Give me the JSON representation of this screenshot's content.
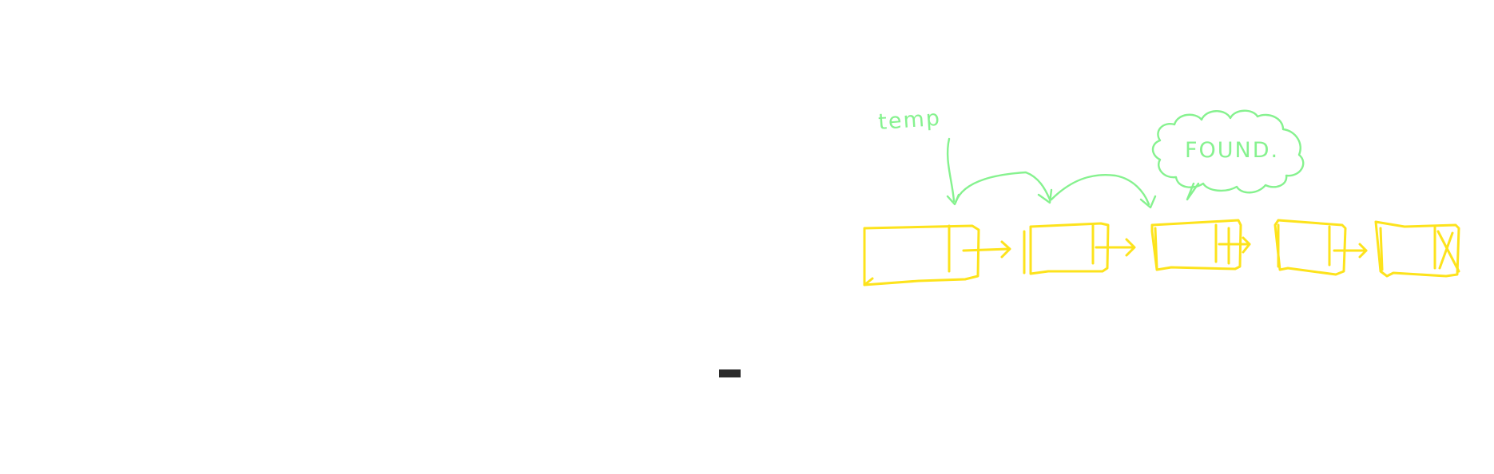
{
  "colors": {
    "background": "#ffffff",
    "list": "#fde31c",
    "annotation": "#86f28f",
    "marker": "#2a2a2a"
  },
  "annotations": {
    "pointer_label": "temp",
    "callout_text": "FOUND."
  },
  "linked_list": {
    "node_count": 5,
    "pointer_at_node": 1,
    "pointer_hops": 2,
    "found_at_node": 3,
    "last_node_next": "null"
  },
  "marker": {
    "icon": "dash-marker"
  }
}
